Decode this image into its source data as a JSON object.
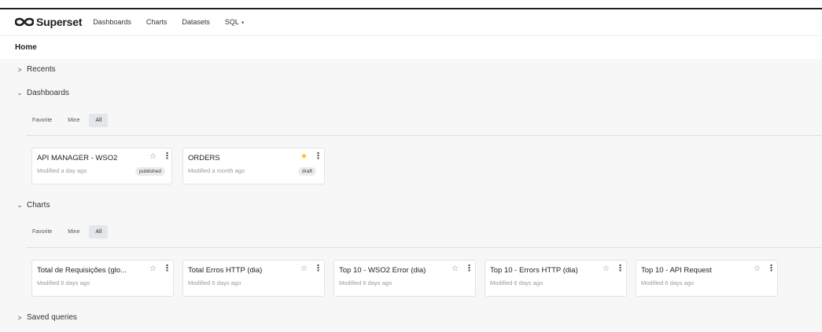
{
  "app": {
    "name": "Superset",
    "nav": [
      "Dashboards",
      "Charts",
      "Datasets",
      "SQL"
    ]
  },
  "page": {
    "title": "Home"
  },
  "sections": {
    "recents": {
      "label": "Recents",
      "expanded": false
    },
    "dashboards": {
      "label": "Dashboards",
      "expanded": true,
      "filters": [
        "Favorite",
        "Mine",
        "All"
      ],
      "active_filter": "All",
      "cards": [
        {
          "title": "API MANAGER - WSO2",
          "modified": "Modified a day ago",
          "status": "published",
          "favorite": false
        },
        {
          "title": "ORDERS",
          "modified": "Modified a month ago",
          "status": "draft",
          "favorite": true
        }
      ]
    },
    "charts": {
      "label": "Charts",
      "expanded": true,
      "filters": [
        "Favorite",
        "Mine",
        "All"
      ],
      "active_filter": "All",
      "cards": [
        {
          "title": "Total de Requisições (glo...",
          "modified": "Modified 6 days ago",
          "favorite": false
        },
        {
          "title": "Total Erros HTTP (dia)",
          "modified": "Modified 6 days ago",
          "favorite": false
        },
        {
          "title": "Top 10 - WSO2 Error (dia)",
          "modified": "Modified 6 days ago",
          "favorite": false
        },
        {
          "title": "Top 10 - Errors HTTP (dia)",
          "modified": "Modified 6 days ago",
          "favorite": false
        },
        {
          "title": "Top 10 - API Request",
          "modified": "Modified 6 days ago",
          "favorite": false
        }
      ]
    },
    "saved_queries": {
      "label": "Saved queries",
      "expanded": false
    }
  },
  "icons": {
    "collapsed": "chevron-right-icon",
    "expanded": "chevron-down-icon",
    "star_empty": "star-outline-icon",
    "star_filled": "star-filled-icon",
    "menu": "more-vertical-icon"
  },
  "colors": {
    "favorite_star": "#f2c200",
    "background": "#f7f7f7",
    "active_filter_bg": "#e3e6ea"
  }
}
